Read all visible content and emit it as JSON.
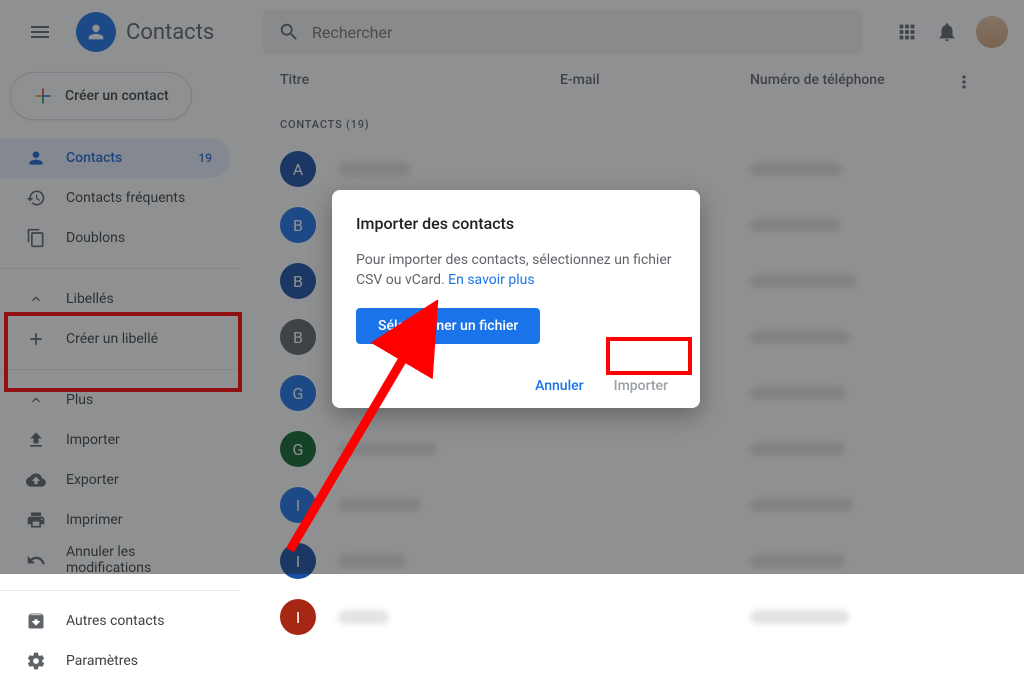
{
  "app_title": "Contacts",
  "search_placeholder": "Rechercher",
  "create_label": "Créer un contact",
  "nav": {
    "contacts": "Contacts",
    "contacts_count": "19",
    "frequent": "Contacts fréquents",
    "duplicates": "Doublons",
    "labels": "Libellés",
    "create_label_item": "Créer un libellé",
    "more": "Plus",
    "import": "Importer",
    "export": "Exporter",
    "print": "Imprimer",
    "undo": "Annuler les modifications",
    "other": "Autres contacts",
    "settings": "Paramètres"
  },
  "columns": {
    "name": "Titre",
    "email": "E-mail",
    "phone": "Numéro de téléphone"
  },
  "section_label": "CONTACTS (19)",
  "contacts": [
    {
      "letter": "A",
      "color": "#174ea6"
    },
    {
      "letter": "B",
      "color": "#1a73e8"
    },
    {
      "letter": "B",
      "color": "#174ea6"
    },
    {
      "letter": "B",
      "color": "#5f6368"
    },
    {
      "letter": "G",
      "color": "#1a73e8"
    },
    {
      "letter": "G",
      "color": "#0d652d"
    },
    {
      "letter": "I",
      "color": "#1a73e8"
    },
    {
      "letter": "I",
      "color": "#174ea6"
    },
    {
      "letter": "I",
      "color": "#a52714"
    }
  ],
  "dialog": {
    "title": "Importer des contacts",
    "body_1": "Pour importer des contacts, sélectionnez un fichier CSV ou vCard. ",
    "learn_more": "En savoir plus",
    "select_file": "Sélectionner un fichier",
    "cancel": "Annuler",
    "import": "Importer"
  }
}
